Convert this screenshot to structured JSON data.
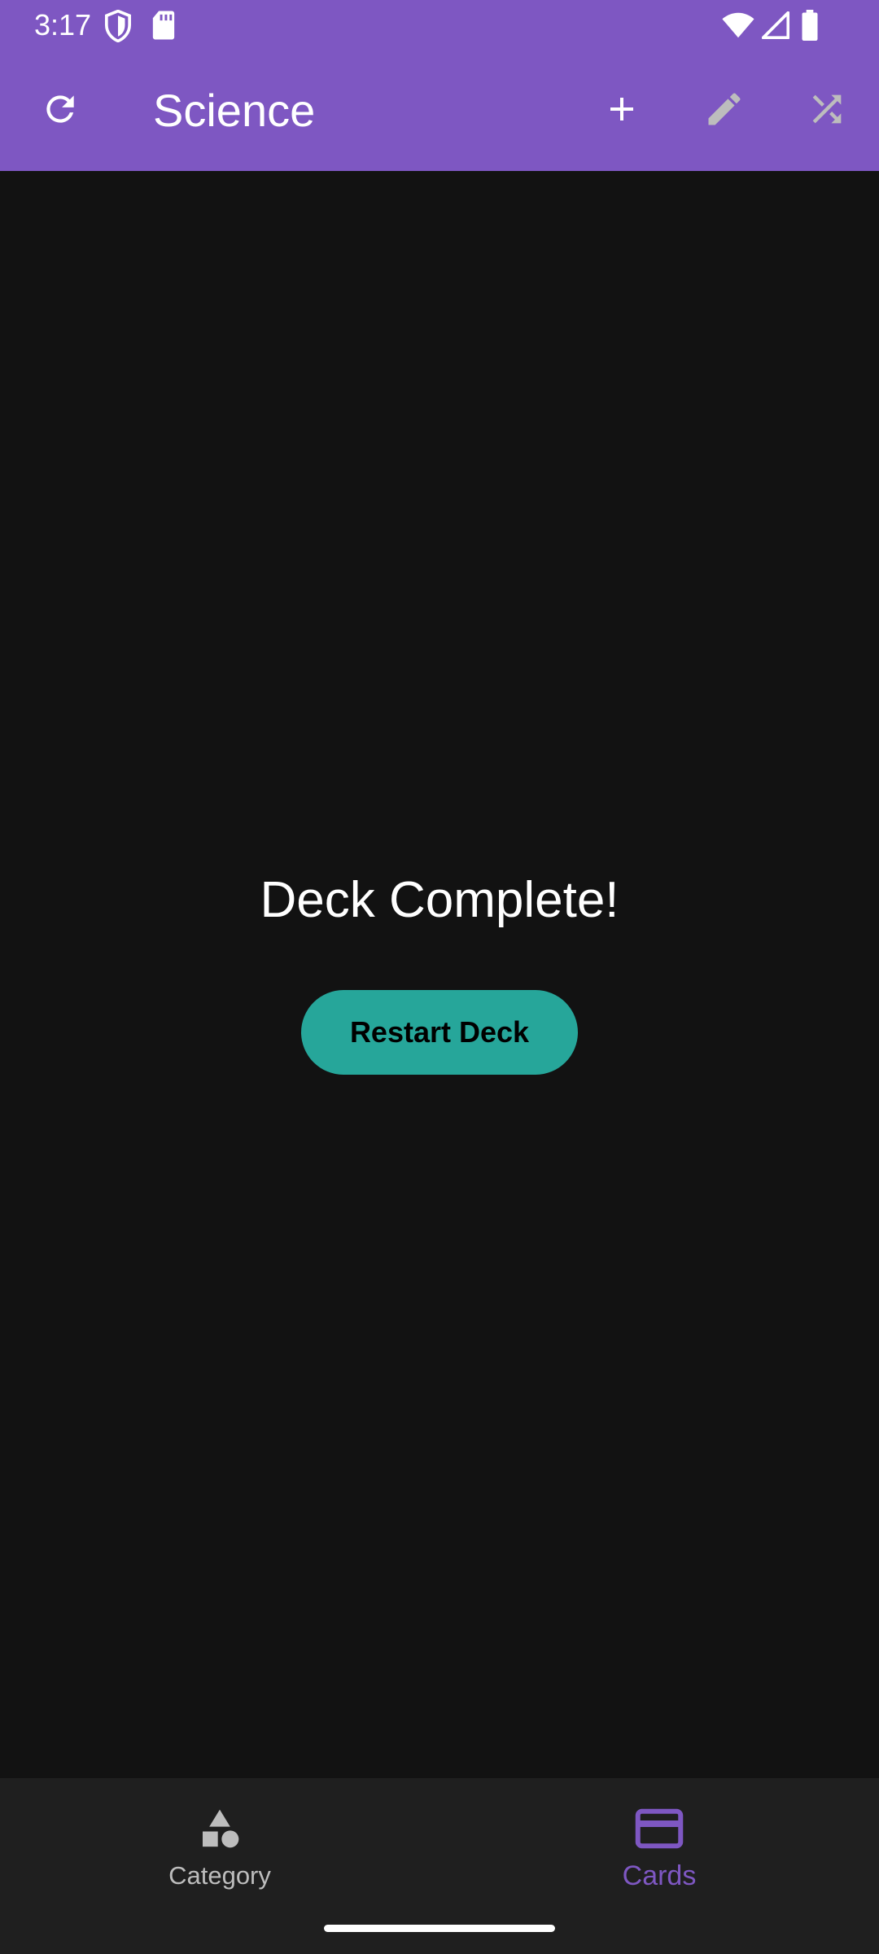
{
  "status_bar": {
    "time": "3:17",
    "icons_left": [
      "shield-icon",
      "sd-card-icon"
    ],
    "icons_right": [
      "wifi-icon",
      "signal-icon",
      "battery-icon"
    ]
  },
  "app_bar": {
    "title": "Science",
    "background": "#7E57C2",
    "actions": [
      "refresh-icon",
      "add-icon",
      "edit-icon",
      "shuffle-icon"
    ]
  },
  "main": {
    "message": "Deck Complete!",
    "restart_button_label": "Restart Deck",
    "button_color": "#26A69A"
  },
  "bottom_nav": {
    "items": [
      {
        "label": "Category",
        "icon": "category-icon",
        "selected": false
      },
      {
        "label": "Cards",
        "icon": "card-icon",
        "selected": true
      }
    ],
    "selected_color": "#7E57C2",
    "unselected_color": "#BDBDBD"
  }
}
